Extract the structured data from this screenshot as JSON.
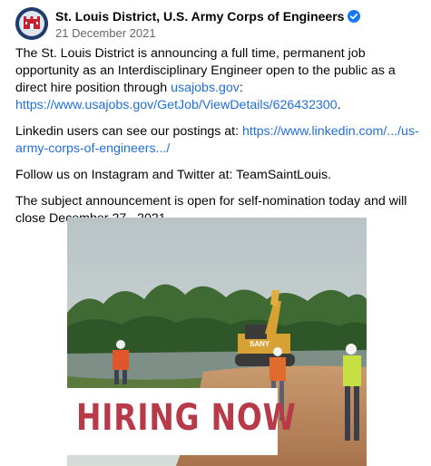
{
  "post": {
    "author": "St. Louis District, U.S. Army Corps of Engineers",
    "date": "21 December 2021",
    "paragraphs": {
      "p1_text": "The St. Louis District is announcing a full time, permanent job opportunity as an Interdisciplinary Engineer open to the public as a direct hire position through ",
      "p1_link1": "usajobs.gov",
      "p1_colon": ": ",
      "p1_link2": "https://www.usajobs.gov/GetJob/ViewDetails/626432300",
      "p1_end": ".",
      "p2_text": "Linkedin users can see our postings at: ",
      "p2_link": "https://www.linkedin.com/.../us-army-corps-of-engineers.../",
      "p3": "Follow us on Instagram and Twitter at: TeamSaintLouis.",
      "p4": "The subject announcement is open for self-nomination today and will close December 27,, 2021."
    },
    "image": {
      "banner_text": "HIRING NOW",
      "excavator_brand": "SANY"
    }
  },
  "colors": {
    "link": "#216fdb",
    "banner_text": "#b83a48",
    "verified_badge": "#1877f2"
  },
  "icons": [
    "army-corps-castle-logo-icon",
    "verified-badge-icon"
  ]
}
